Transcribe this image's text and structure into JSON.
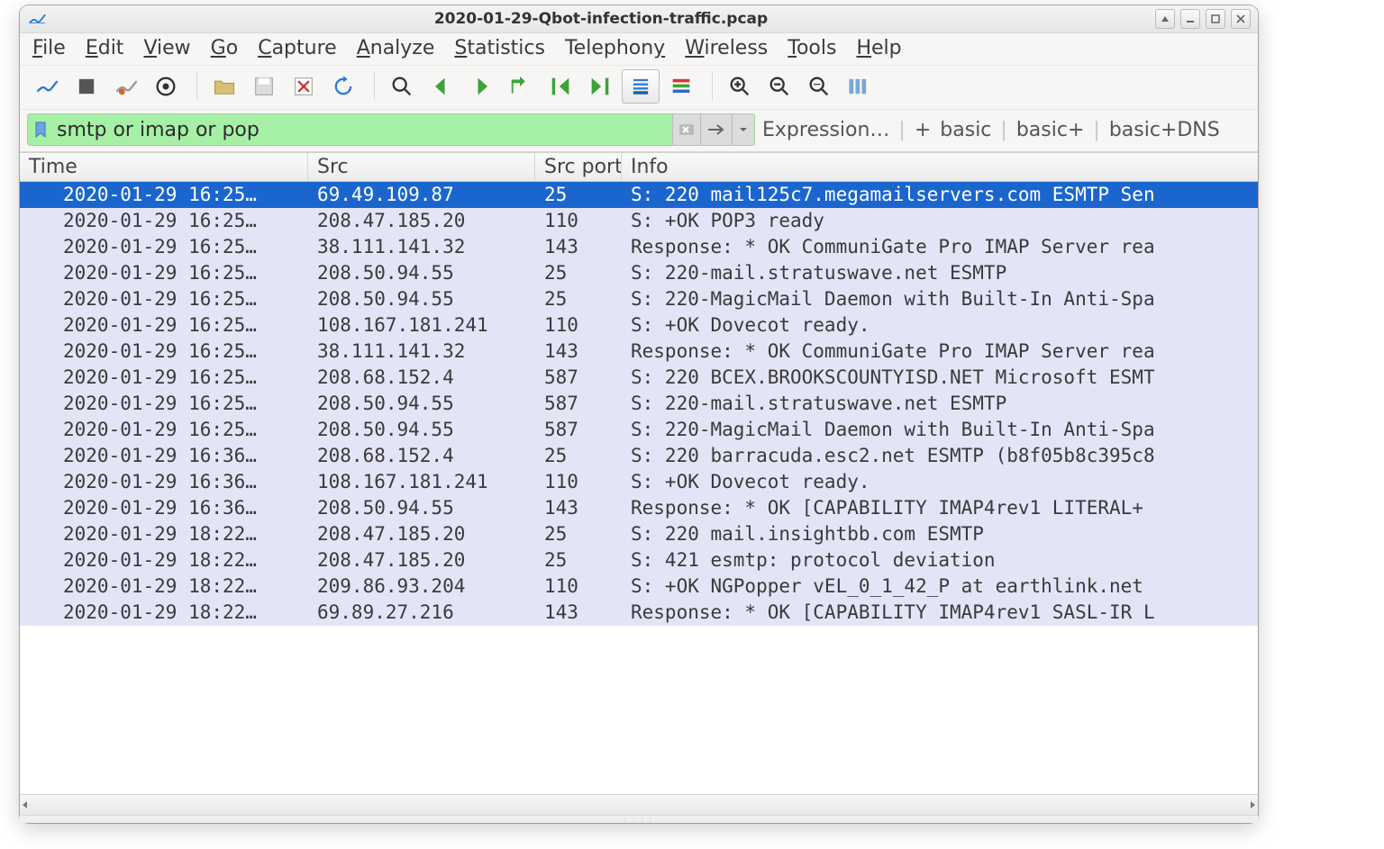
{
  "window": {
    "title": "2020-01-29-Qbot-infection-traffic.pcap"
  },
  "menus": {
    "file": {
      "letter": "F",
      "rest": "ile"
    },
    "edit": {
      "letter": "E",
      "rest": "dit"
    },
    "view": {
      "letter": "V",
      "rest": "iew"
    },
    "go": {
      "letter": "G",
      "rest": "o"
    },
    "capture": {
      "letter": "C",
      "rest": "apture"
    },
    "analyze": {
      "letter": "A",
      "rest": "nalyze"
    },
    "statistics": {
      "letter": "S",
      "rest": "tatistics"
    },
    "telephony": {
      "letter": "",
      "rest": "Telephon",
      "tail_letter": "y"
    },
    "wireless": {
      "letter": "W",
      "rest": "ireless"
    },
    "tools": {
      "letter": "T",
      "rest": "ools"
    },
    "help": {
      "letter": "H",
      "rest": "elp"
    }
  },
  "filter": {
    "value": "smtp or imap or pop",
    "expression_label": "Expression…",
    "plus": "+",
    "basic": "basic",
    "basicplus": "basic+",
    "basicdns": "basic+DNS"
  },
  "columns": {
    "time": "Time",
    "src": "Src",
    "srcport": "Src port",
    "info": "Info"
  },
  "rows": [
    {
      "time": "2020-01-29 16:25…",
      "src": "69.49.109.87",
      "port": "25",
      "info": "S: 220 mail125c7.megamailservers.com ESMTP Sen",
      "selected": true
    },
    {
      "time": "2020-01-29 16:25…",
      "src": "208.47.185.20",
      "port": "110",
      "info": "S: +OK POP3 ready"
    },
    {
      "time": "2020-01-29 16:25…",
      "src": "38.111.141.32",
      "port": "143",
      "info": "Response: * OK CommuniGate Pro IMAP Server rea"
    },
    {
      "time": "2020-01-29 16:25…",
      "src": "208.50.94.55",
      "port": "25",
      "info": "S: 220-mail.stratuswave.net ESMTP"
    },
    {
      "time": "2020-01-29 16:25…",
      "src": "208.50.94.55",
      "port": "25",
      "info": "S: 220-MagicMail Daemon with Built-In Anti-Spa"
    },
    {
      "time": "2020-01-29 16:25…",
      "src": "108.167.181.241",
      "port": "110",
      "info": "S: +OK Dovecot ready."
    },
    {
      "time": "2020-01-29 16:25…",
      "src": "38.111.141.32",
      "port": "143",
      "info": "Response: * OK CommuniGate Pro IMAP Server rea"
    },
    {
      "time": "2020-01-29 16:25…",
      "src": "208.68.152.4",
      "port": "587",
      "info": "S: 220 BCEX.BROOKSCOUNTYISD.NET Microsoft ESMT"
    },
    {
      "time": "2020-01-29 16:25…",
      "src": "208.50.94.55",
      "port": "587",
      "info": "S: 220-mail.stratuswave.net ESMTP"
    },
    {
      "time": "2020-01-29 16:25…",
      "src": "208.50.94.55",
      "port": "587",
      "info": "S: 220-MagicMail Daemon with Built-In Anti-Spa"
    },
    {
      "time": "2020-01-29 16:36…",
      "src": "208.68.152.4",
      "port": "25",
      "info": "S: 220 barracuda.esc2.net ESMTP (b8f05b8c395c8"
    },
    {
      "time": "2020-01-29 16:36…",
      "src": "108.167.181.241",
      "port": "110",
      "info": "S: +OK Dovecot ready."
    },
    {
      "time": "2020-01-29 16:36…",
      "src": "208.50.94.55",
      "port": "143",
      "info": "Response: * OK [CAPABILITY IMAP4rev1 LITERAL+ "
    },
    {
      "time": "2020-01-29 18:22…",
      "src": "208.47.185.20",
      "port": "25",
      "info": "S: 220 mail.insightbb.com ESMTP"
    },
    {
      "time": "2020-01-29 18:22…",
      "src": "208.47.185.20",
      "port": "25",
      "info": "S: 421 esmtp: protocol deviation"
    },
    {
      "time": "2020-01-29 18:22…",
      "src": "209.86.93.204",
      "port": "110",
      "info": "S: +OK NGPopper vEL_0_1_42_P at earthlink.net "
    },
    {
      "time": "2020-01-29 18:22…",
      "src": "69.89.27.216",
      "port": "143",
      "info": "Response: * OK [CAPABILITY IMAP4rev1 SASL-IR L"
    }
  ]
}
